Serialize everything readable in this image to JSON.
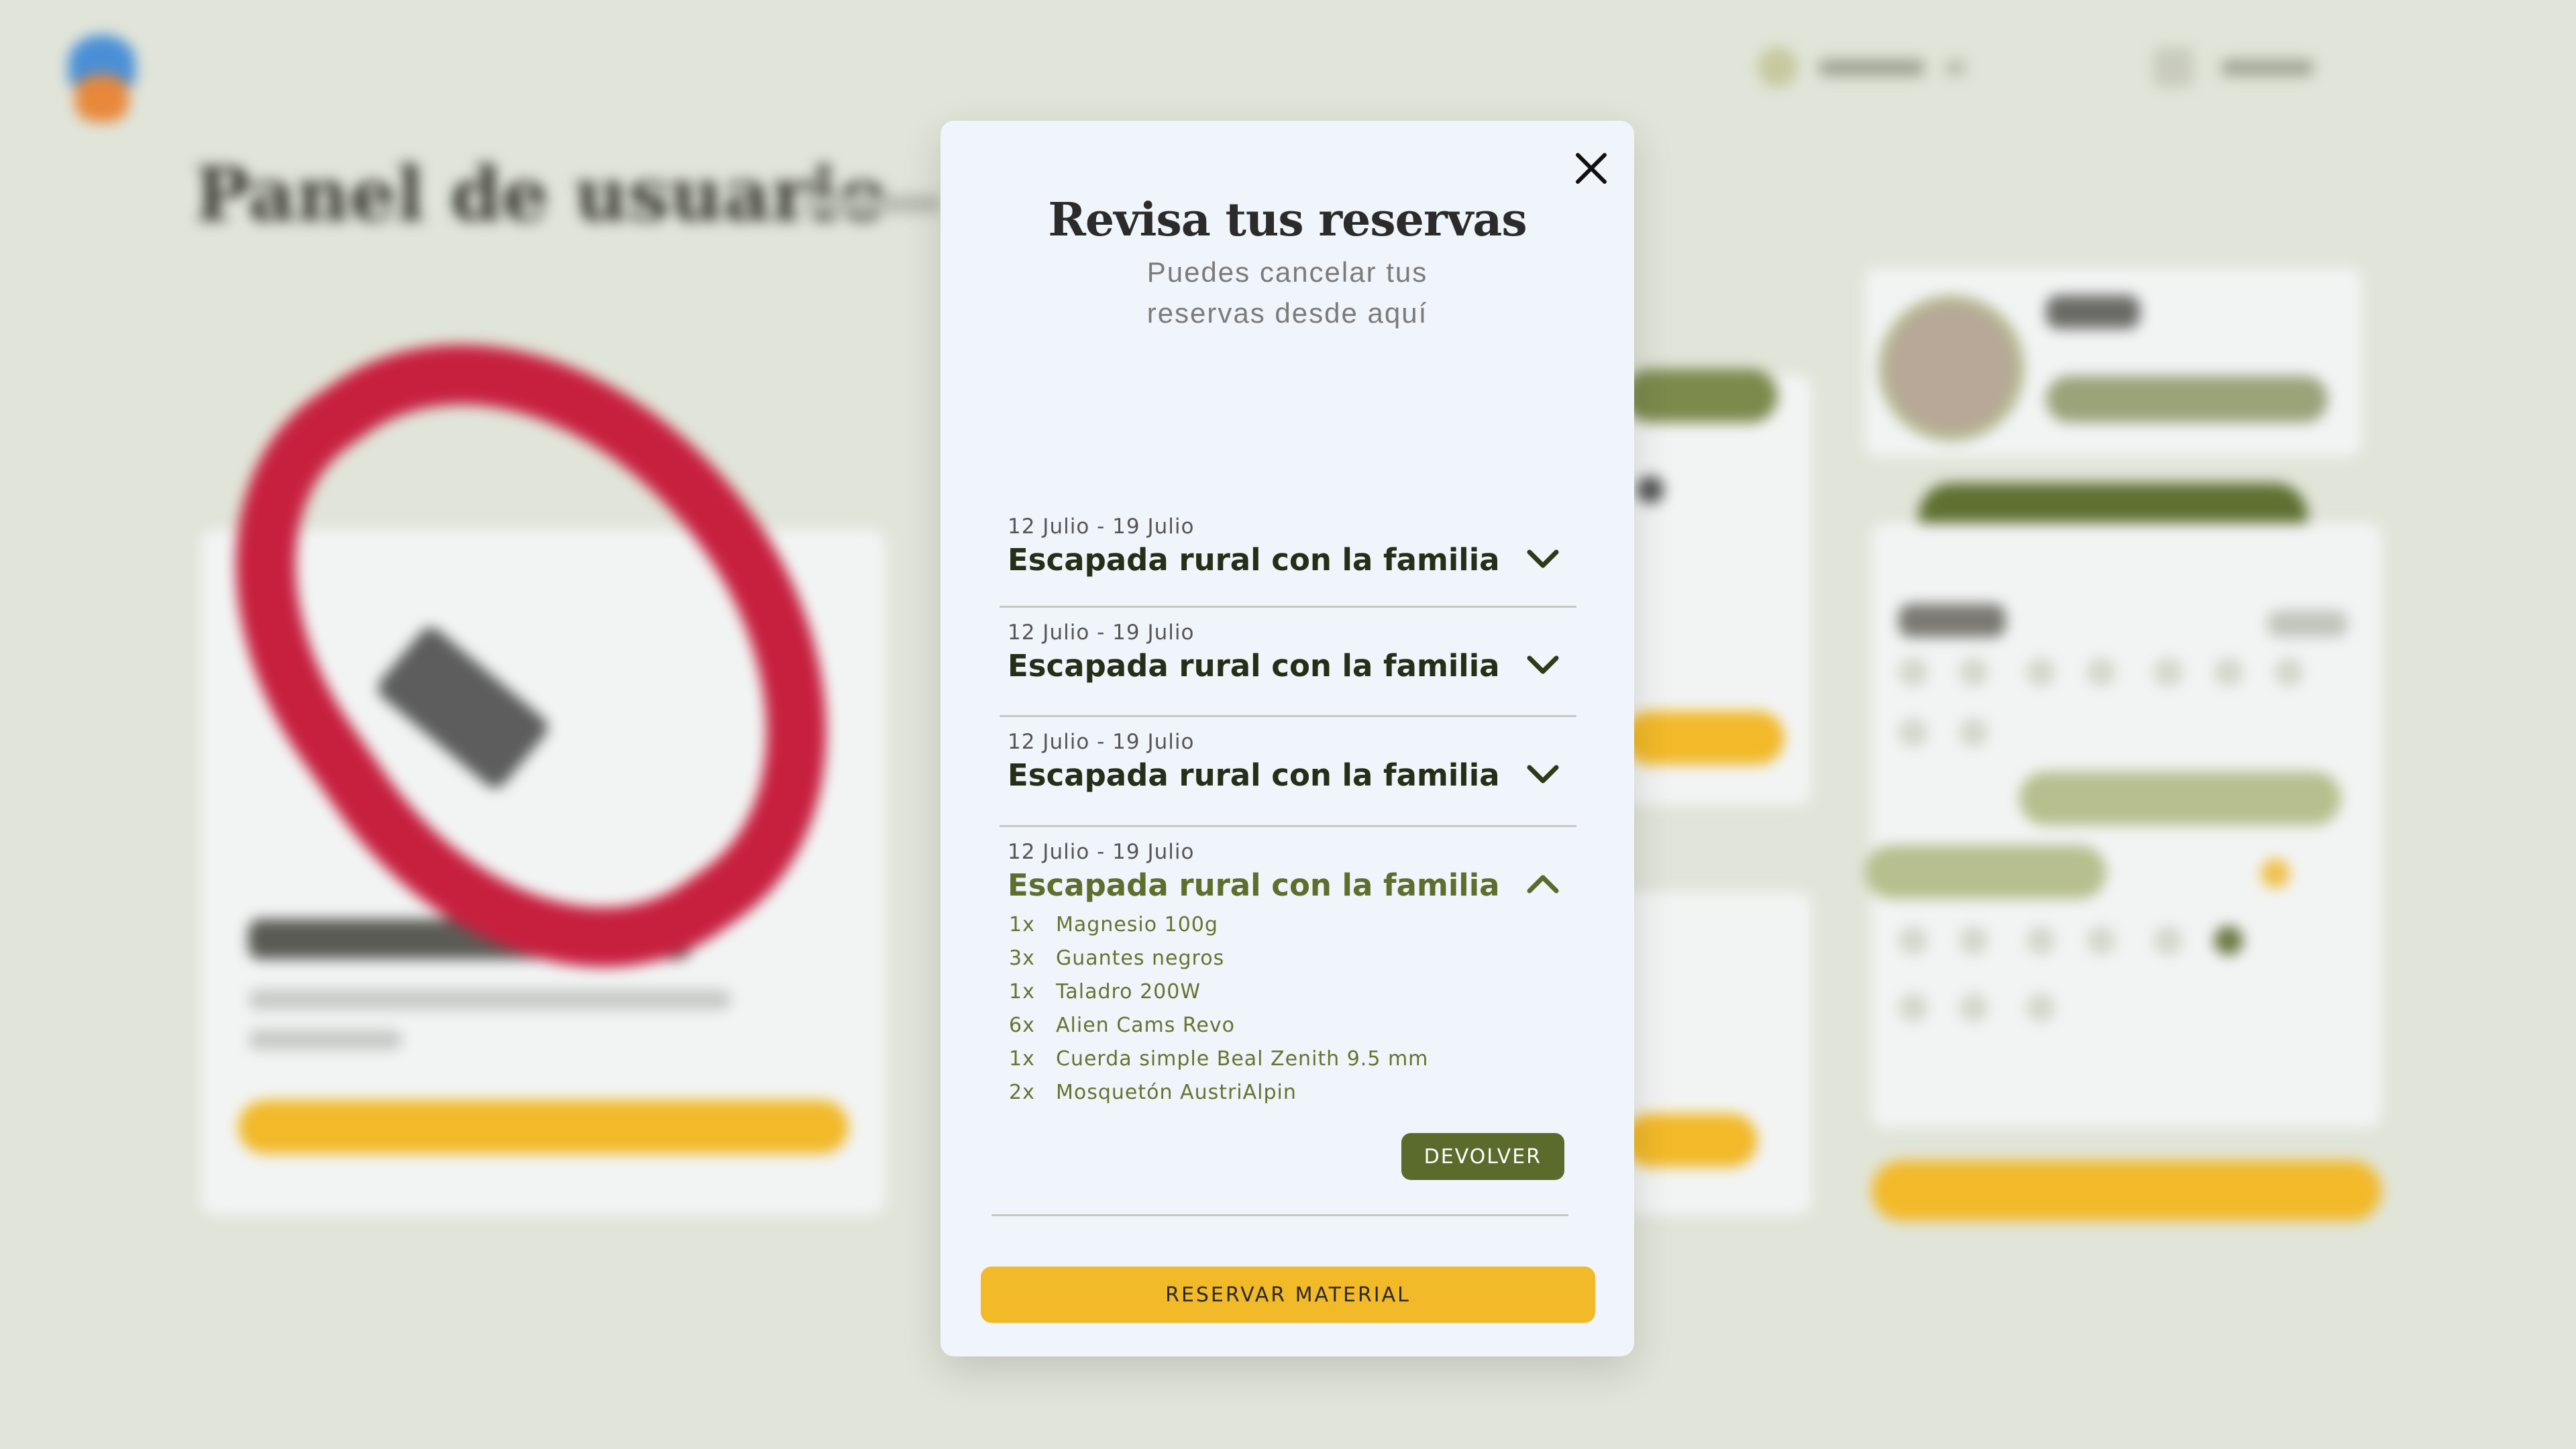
{
  "modal": {
    "title": "Revisa tus reservas",
    "subtitle_line1": "Puedes cancelar tus",
    "subtitle_line2": "reservas desde aquí",
    "close_icon": "close-icon",
    "reservations": [
      {
        "dates": "12 Julio - 19 Julio",
        "name": "Escapada rural con la familia",
        "expanded": false
      },
      {
        "dates": "12 Julio - 19 Julio",
        "name": "Escapada rural con la familia",
        "expanded": false
      },
      {
        "dates": "12 Julio - 19 Julio",
        "name": "Escapada rural con la familia",
        "expanded": false
      },
      {
        "dates": "12 Julio - 19 Julio",
        "name": "Escapada rural con la familia",
        "expanded": true,
        "items": [
          {
            "qty": "1x",
            "name": "Magnesio 100g"
          },
          {
            "qty": "3x",
            "name": "Guantes negros"
          },
          {
            "qty": "1x",
            "name": "Taladro 200W"
          },
          {
            "qty": "6x",
            "name": "Alien Cams Revo"
          },
          {
            "qty": "1x",
            "name": "Cuerda simple Beal Zenith 9.5 mm"
          },
          {
            "qty": "2x",
            "name": "Mosquetón AustriAlpin"
          }
        ],
        "return_label": "DEVOLVER"
      }
    ],
    "reserve_label": "RESERVAR MATERIAL"
  },
  "background": {
    "page_title": "Panel de usuario"
  },
  "colors": {
    "accent_green": "#5b6b2c",
    "accent_yellow": "#f2b929",
    "modal_bg": "#f0f4fb",
    "page_bg": "#e1e5d9"
  }
}
